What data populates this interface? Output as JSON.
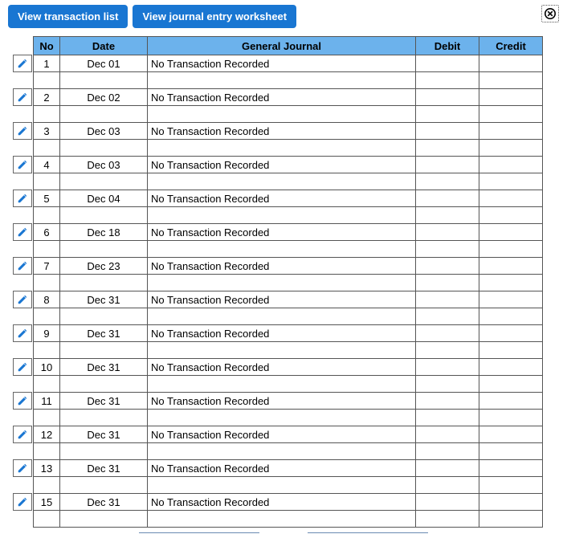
{
  "toolbar": {
    "view_list_label": "View transaction list",
    "view_worksheet_label": "View journal entry worksheet"
  },
  "table": {
    "headers": {
      "no": "No",
      "date": "Date",
      "journal": "General Journal",
      "debit": "Debit",
      "credit": "Credit"
    },
    "rows": [
      {
        "no": "1",
        "date": "Dec 01",
        "journal": "No Transaction Recorded",
        "debit": "",
        "credit": ""
      },
      {
        "no": "2",
        "date": "Dec 02",
        "journal": "No Transaction Recorded",
        "debit": "",
        "credit": ""
      },
      {
        "no": "3",
        "date": "Dec 03",
        "journal": "No Transaction Recorded",
        "debit": "",
        "credit": ""
      },
      {
        "no": "4",
        "date": "Dec 03",
        "journal": "No Transaction Recorded",
        "debit": "",
        "credit": ""
      },
      {
        "no": "5",
        "date": "Dec 04",
        "journal": "No Transaction Recorded",
        "debit": "",
        "credit": ""
      },
      {
        "no": "6",
        "date": "Dec 18",
        "journal": "No Transaction Recorded",
        "debit": "",
        "credit": ""
      },
      {
        "no": "7",
        "date": "Dec 23",
        "journal": "No Transaction Recorded",
        "debit": "",
        "credit": ""
      },
      {
        "no": "8",
        "date": "Dec 31",
        "journal": "No Transaction Recorded",
        "debit": "",
        "credit": ""
      },
      {
        "no": "9",
        "date": "Dec 31",
        "journal": "No Transaction Recorded",
        "debit": "",
        "credit": ""
      },
      {
        "no": "10",
        "date": "Dec 31",
        "journal": "No Transaction Recorded",
        "debit": "",
        "credit": ""
      },
      {
        "no": "11",
        "date": "Dec 31",
        "journal": "No Transaction Recorded",
        "debit": "",
        "credit": ""
      },
      {
        "no": "12",
        "date": "Dec 31",
        "journal": "No Transaction Recorded",
        "debit": "",
        "credit": ""
      },
      {
        "no": "13",
        "date": "Dec 31",
        "journal": "No Transaction Recorded",
        "debit": "",
        "credit": ""
      },
      {
        "no": "15",
        "date": "Dec 31",
        "journal": "No Transaction Recorded",
        "debit": "",
        "credit": ""
      }
    ]
  }
}
